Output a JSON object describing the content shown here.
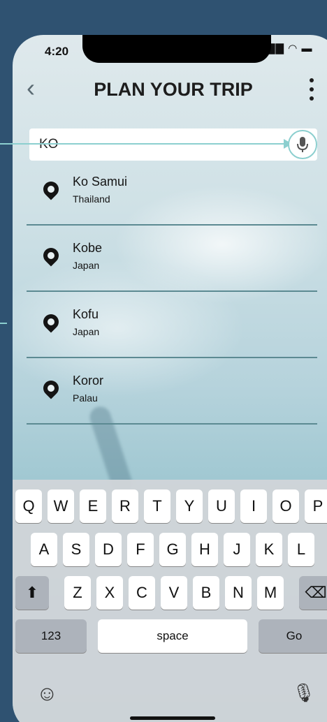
{
  "status_bar": {
    "time": "4:20",
    "indicators": "▇▇ ◠ ▬"
  },
  "header": {
    "back_label": "‹",
    "title": "PLAN YOUR TRIP"
  },
  "search": {
    "value": "KO",
    "placeholder": ""
  },
  "results": [
    {
      "city": "Ko Samui",
      "country": "Thailand"
    },
    {
      "city": "Kobe",
      "country": "Japan"
    },
    {
      "city": "Kofu",
      "country": "Japan"
    },
    {
      "city": "Koror",
      "country": "Palau"
    }
  ],
  "keyboard": {
    "row1": [
      "Q",
      "W",
      "E",
      "R",
      "T",
      "Y",
      "U",
      "I",
      "O",
      "P"
    ],
    "row2": [
      "A",
      "S",
      "D",
      "F",
      "G",
      "H",
      "J",
      "K",
      "L"
    ],
    "row3": [
      "Z",
      "X",
      "C",
      "V",
      "B",
      "N",
      "M"
    ],
    "shift": "⬆",
    "delete": "⌫",
    "numbers": "123",
    "space": "space",
    "go": "Go",
    "emoji": "☺",
    "dictation": "🎙"
  },
  "icons": {
    "pin": "map-pin-icon",
    "mic": "microphone-icon",
    "menu": "more-vertical-icon"
  },
  "colors": {
    "accent": "#8ccfcf",
    "background": "#2f5271",
    "divider": "#5c8a92"
  }
}
